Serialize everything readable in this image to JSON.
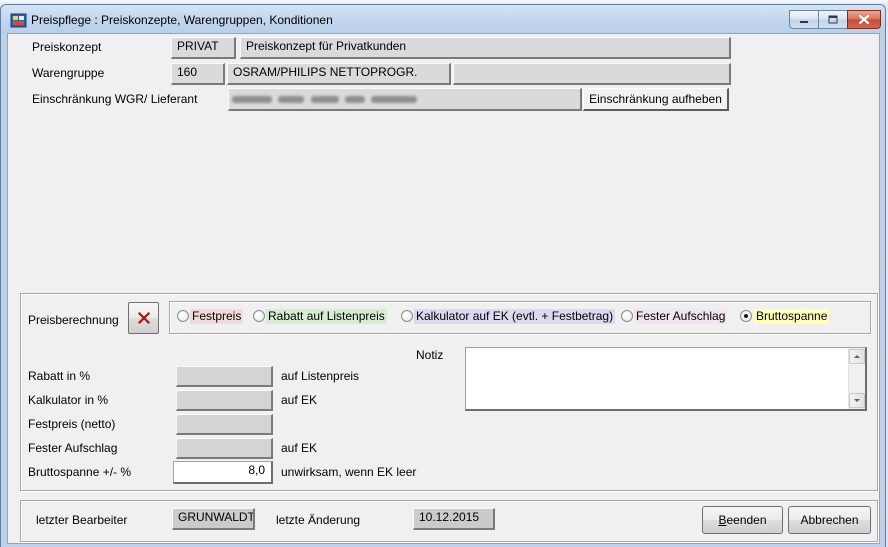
{
  "window": {
    "title": "Preispflege : Preiskonzepte, Warengruppen, Konditionen"
  },
  "selection": {
    "preiskonzept": {
      "label": "Preiskonzept",
      "code": "PRIVAT",
      "description": "Preiskonzept für Privatkunden"
    },
    "warengruppe": {
      "label": "Warengruppe",
      "code": "160",
      "description": "OSRAM/PHILIPS NETTOPROGR.",
      "extra": ""
    },
    "einschraenkung": {
      "label": "Einschränkung WGR/ Lieferant",
      "button_label": "Einschränkung aufheben"
    }
  },
  "preisberechnung": {
    "label": "Preisberechnung",
    "options": [
      {
        "label": "Festpreis",
        "color": "#f3dada",
        "selected": false
      },
      {
        "label": "Rabatt auf Listenpreis",
        "color": "#d7ecd3",
        "selected": false
      },
      {
        "label": "Kalkulator auf EK (evtl. + Festbetrag)",
        "color": "#dadaf1",
        "selected": false
      },
      {
        "label": "Fester Aufschlag",
        "color": "#f3e4f1",
        "selected": false
      },
      {
        "label": "Bruttospanne",
        "color": "#ffffba",
        "selected": true
      }
    ]
  },
  "notiz": {
    "label": "Notiz",
    "value": ""
  },
  "konditionen": [
    {
      "label": "Rabatt in %",
      "value": "",
      "suffix": "auf Listenpreis"
    },
    {
      "label": "Kalkulator in %",
      "value": "",
      "suffix": "auf EK"
    },
    {
      "label": "Festpreis (netto)",
      "value": ""
    },
    {
      "label": "Fester Aufschlag",
      "value": "",
      "suffix": "auf EK"
    },
    {
      "label": "Bruttospanne +/- %",
      "value": "8,0",
      "suffix": "unwirksam, wenn EK leer"
    }
  ],
  "footer": {
    "last_editor_label": "letzter Bearbeiter",
    "last_editor": "GRUNWALDT",
    "last_change_label": "letzte Änderung",
    "last_change": "10.12.2015",
    "quit_label": "Beenden",
    "cancel_label": "Abbrechen"
  },
  "colors": {
    "clear_icon": "#b31212",
    "close_glyph": "#ffffff"
  }
}
